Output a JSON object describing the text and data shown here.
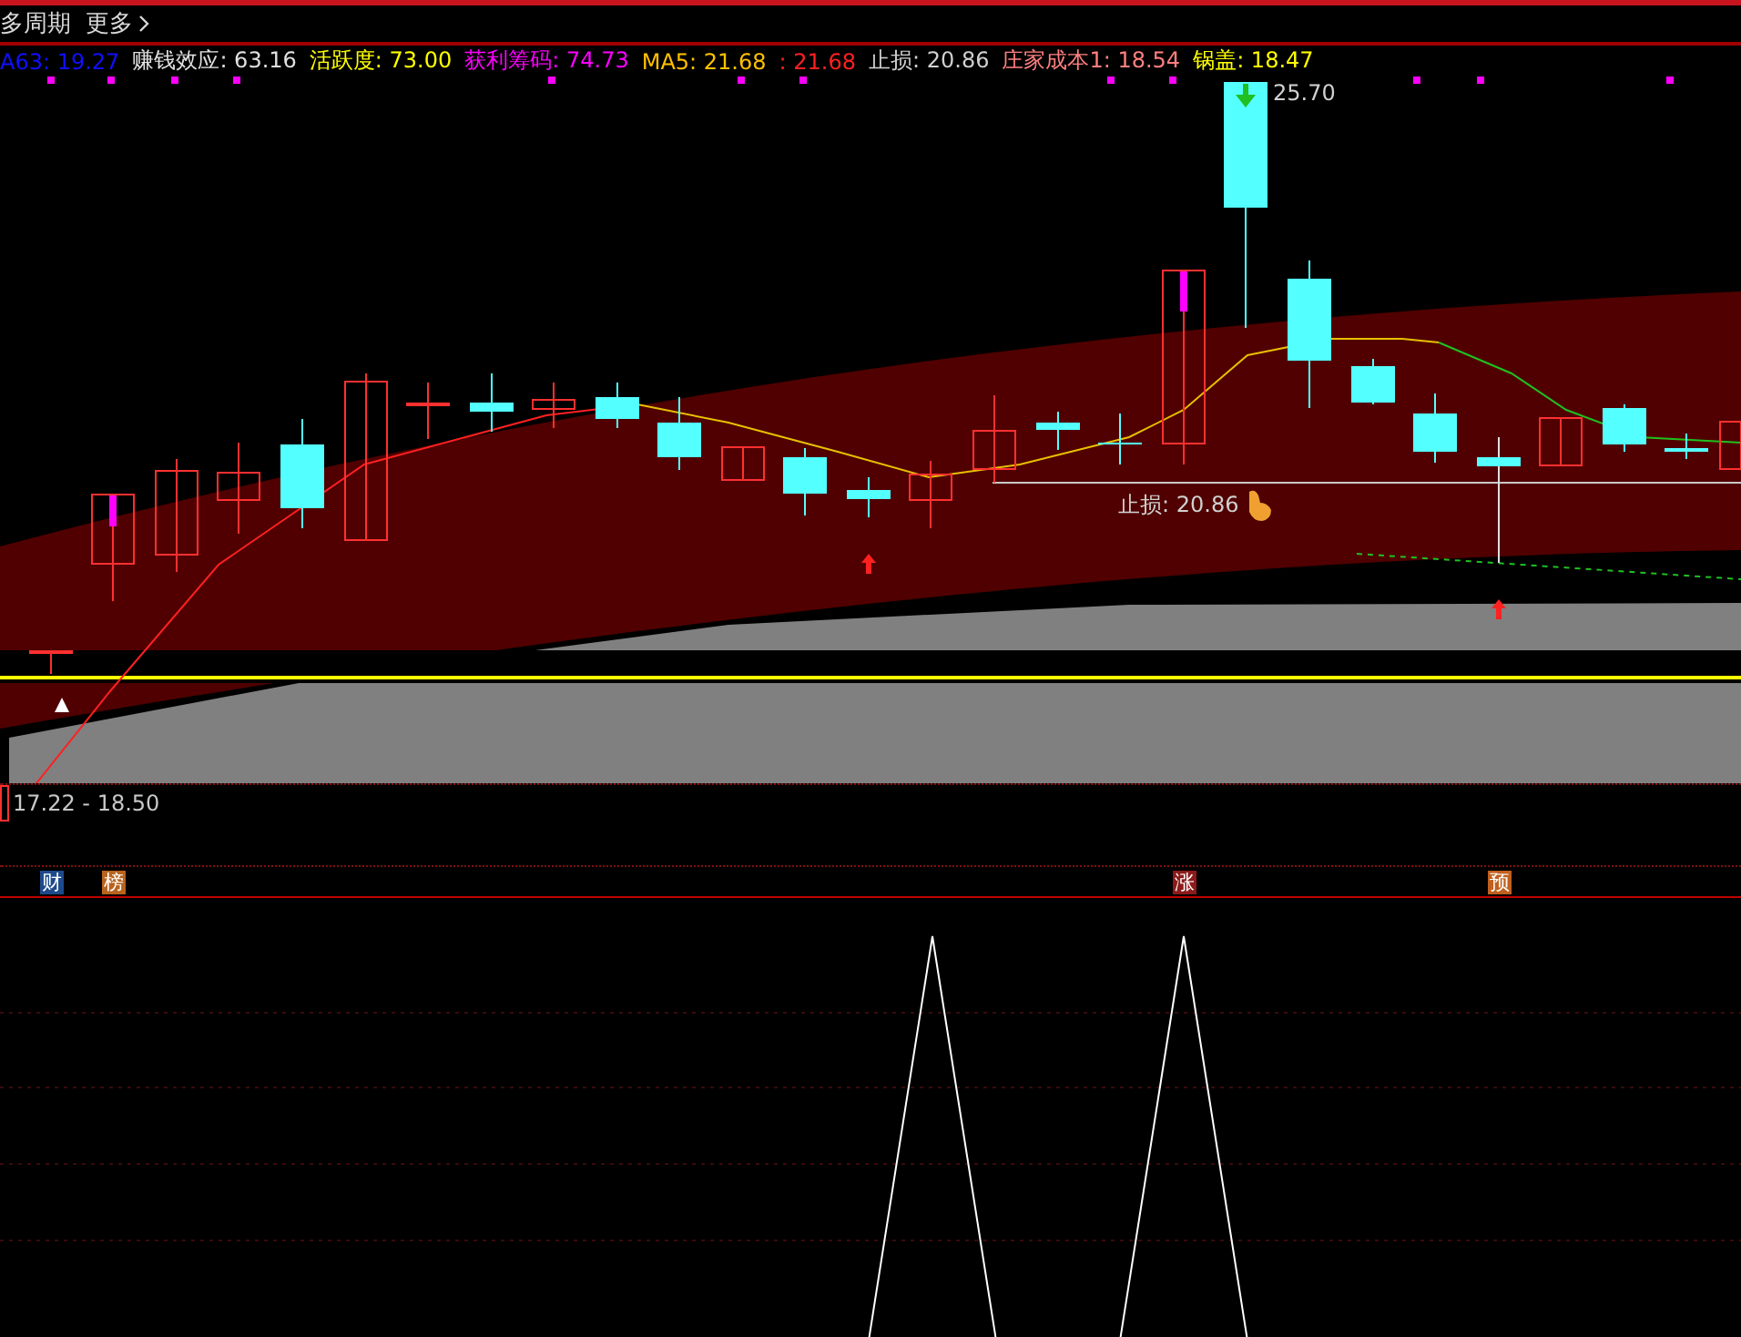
{
  "toolbar": {
    "period": "多周期",
    "more": "更多"
  },
  "legend": [
    {
      "text": "A63: 19.27",
      "color": "#1010ff"
    },
    {
      "text": "赚钱效应: 63.16",
      "color": "#e0e0e0"
    },
    {
      "text": "活跃度: 73.00",
      "color": "#ffff00"
    },
    {
      "text": "获利筹码: 74.73",
      "color": "#ff00ff"
    },
    {
      "text": "MA5: 21.68",
      "color": "#ffc000"
    },
    {
      "text": ": 21.68",
      "color": "#ff2020"
    },
    {
      "text": "止损: 20.86",
      "color": "#d0d0d0"
    },
    {
      "text": "庄家成本1: 18.54",
      "color": "#ff8080"
    },
    {
      "text": "锅盖: 18.47",
      "color": "#ffff00"
    }
  ],
  "chart": {
    "labels": [
      {
        "kind": "high",
        "text": "25.70"
      },
      {
        "kind": "stop",
        "text": "止损: 20.86"
      }
    ]
  },
  "range_label": "17.22 - 18.50",
  "badges": [
    {
      "text": "财",
      "color": "#1e4a8c"
    },
    {
      "text": "榜",
      "color": "#b8641e"
    },
    {
      "text": "涨",
      "color": "#8c1a1a"
    },
    {
      "text": "预",
      "color": "#c0601e"
    }
  ]
}
